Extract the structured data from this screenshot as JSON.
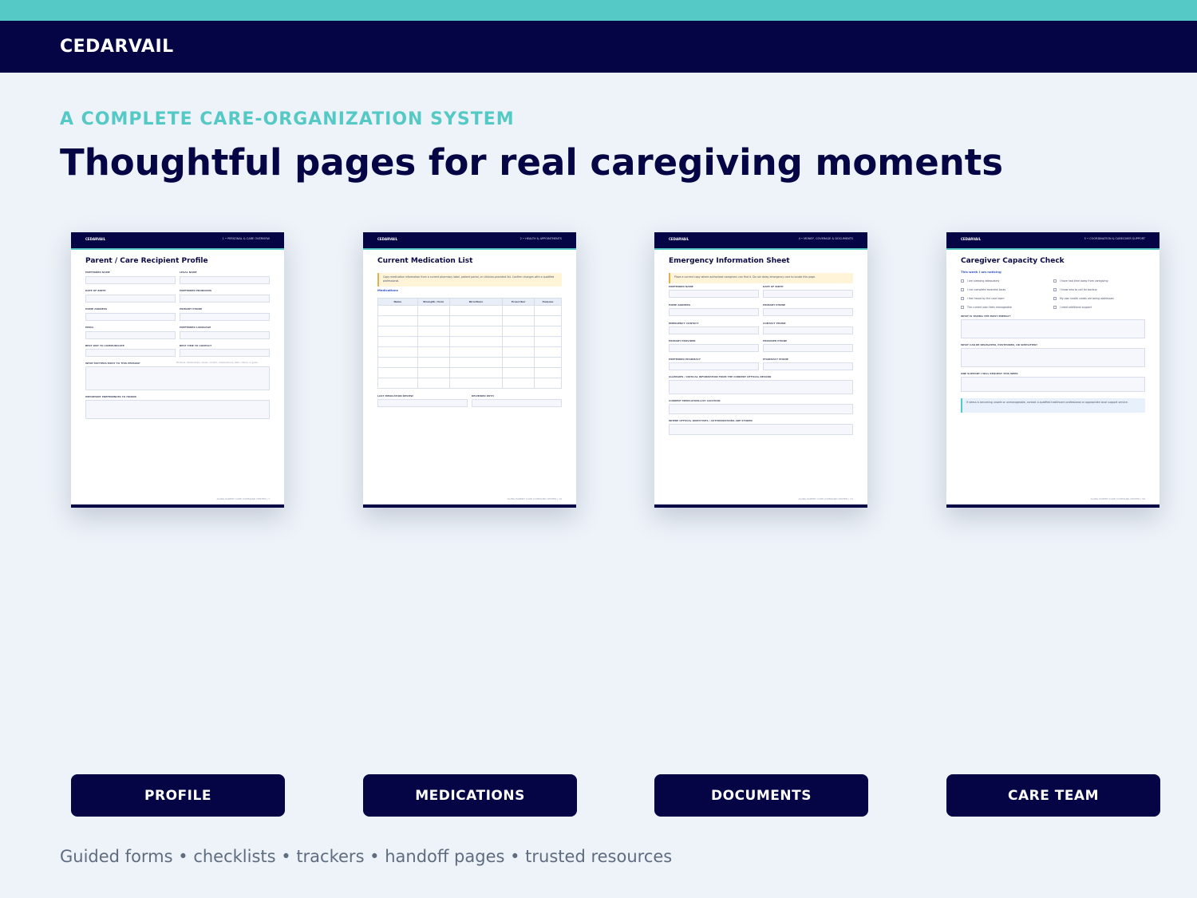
{
  "brand": "CEDARVAIL",
  "eyebrow": "A COMPLETE CARE-ORGANIZATION SYSTEM",
  "headline": "Thoughtful pages for real caregiving moments",
  "pages": [
    {
      "brand": "CEDARVAIL",
      "section": "1 • PERSONAL & CARE OVERVIEW",
      "title": "Parent / Care Recipient Profile",
      "labels": [
        "PREFERRED NAME",
        "LEGAL NAME",
        "DATE OF BIRTH",
        "PREFERRED PRONOUNS",
        "HOME ADDRESS",
        "PRIMARY PHONE",
        "EMAIL",
        "PREFERRED LANGUAGE",
        "BEST WAY TO COMMUNICATE",
        "BEST TIME TO CONTACT",
        "WHAT MATTERS MOST TO THIS PERSON?",
        "IMPORTANT PREFERENCES TO HONOR"
      ],
      "hint": "Routines, relationships, values, comfort, independence, faith, culture, or goals.",
      "footer": "AGING PARENT CARE COMMAND CENTER | 7"
    },
    {
      "brand": "CEDARVAIL",
      "section": "2 • HEALTH & APPOINTMENTS",
      "title": "Current Medication List",
      "note": "Copy medication information from a current pharmacy label, patient portal, or clinician-provided list. Confirm changes with a qualified professional.",
      "subhead": "Medications",
      "columns": [
        "Name",
        "Strength / form",
        "Directions",
        "Prescriber",
        "Purpose"
      ],
      "labels": [
        "LAST MEDICATION REVIEW",
        "REVIEWED WITH"
      ],
      "footer": "AGING PARENT CARE COMMAND CENTER | 16"
    },
    {
      "brand": "CEDARVAIL",
      "section": "4 • MONEY, COVERAGE & DOCUMENTS",
      "title": "Emergency Information Sheet",
      "note": "Place a current copy where authorized caregivers can find it. Do not delay emergency care to locate this page.",
      "labels": [
        "PREFERRED NAME",
        "DATE OF BIRTH",
        "HOME ADDRESS",
        "PRIMARY PHONE",
        "EMERGENCY CONTACT",
        "CONTACT PHONE",
        "PRIMARY PROVIDER",
        "PROVIDER PHONE",
        "PREFERRED PHARMACY",
        "PHARMACY PHONE",
        "ALLERGIES / CRITICAL INFORMATION FROM THE CURRENT OFFICIAL RECORD",
        "CURRENT MEDICATION-LIST LOCATION",
        "WHERE OFFICIAL DIRECTIVES / AUTHORIZATIONS ARE STORED"
      ],
      "footer": "AGING PARENT CARE COMMAND CENTER | 41"
    },
    {
      "brand": "CEDARVAIL",
      "section": "5 • COORDINATION & CAREGIVER SUPPORT",
      "title": "Caregiver Capacity Check",
      "subhead": "This week I am noticing",
      "checks": [
        "I am sleeping adequately",
        "I have had time away from caregiving",
        "I can complete essential tasks",
        "I know who to call for backup",
        "I feel heard by the care team",
        "My own health needs are being addressed",
        "The current plan feels manageable",
        "I need additional support"
      ],
      "labels": [
        "WHAT IS TAKING THE MOST ENERGY?",
        "WHAT CAN BE DELEGATED, POSTPONED, OR SIMPLIFIED?",
        "ONE SUPPORT I WILL REQUEST THIS WEEK"
      ],
      "callout": "If stress is becoming unsafe or unmanageable, contact a qualified healthcare professional or appropriate local support service.",
      "footer": "AGING PARENT CARE COMMAND CENTER | 56"
    }
  ],
  "buttons": [
    "PROFILE",
    "MEDICATIONS",
    "DOCUMENTS",
    "CARE TEAM"
  ],
  "footer": "Guided forms • checklists • trackers • handoff pages • trusted resources",
  "colors": {
    "navy": "#050444",
    "teal": "#55c9c6",
    "background": "#eef3f9"
  }
}
